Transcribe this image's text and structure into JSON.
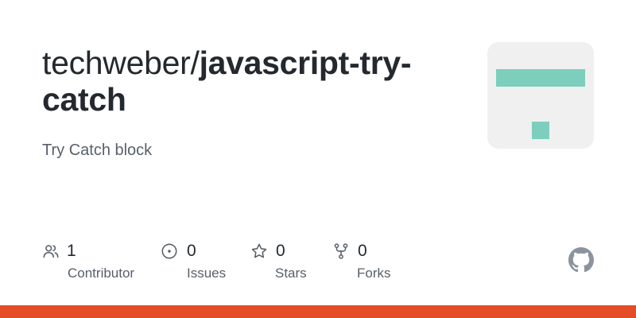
{
  "repo": {
    "owner": "techweber",
    "separator": "/",
    "name": "javascript-try-catch",
    "description": "Try Catch block"
  },
  "stats": [
    {
      "icon": "people-icon",
      "count": "1",
      "label": "Contributor"
    },
    {
      "icon": "issue-icon",
      "count": "0",
      "label": "Issues"
    },
    {
      "icon": "star-icon",
      "count": "0",
      "label": "Stars"
    },
    {
      "icon": "fork-icon",
      "count": "0",
      "label": "Forks"
    }
  ],
  "colors": {
    "avatar_accent": "#7dcebd",
    "avatar_bg": "#f0f0f0",
    "bottom_bar": "#e34c26",
    "icon_gray": "#57606a",
    "github_mark": "#8b949e"
  },
  "icons": {
    "brand": "github-mark-icon"
  }
}
